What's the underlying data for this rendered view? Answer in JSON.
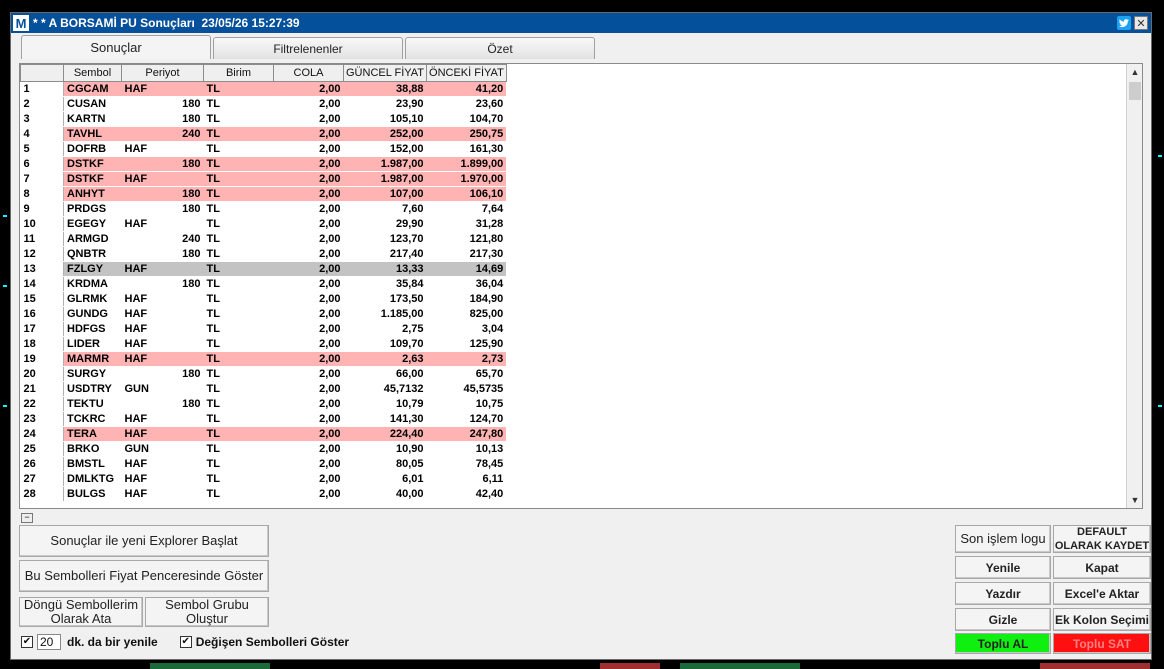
{
  "window": {
    "title": "* * A BORSAMİ PU Sonuçları  23/05/26 15:27:39",
    "logo": "M"
  },
  "tabs": [
    {
      "label": "Sonuçlar",
      "active": true
    },
    {
      "label": "Filtrelenenler",
      "active": false
    },
    {
      "label": "Özet",
      "active": false
    }
  ],
  "columns": [
    "",
    "Sembol",
    "Periyot",
    "Birim",
    "COLA",
    "GÜNCEL FİYAT",
    "ÖNCEKİ FİYAT"
  ],
  "rows": [
    {
      "no": "1",
      "sym": "CGCAM",
      "per": "HAF",
      "unit": "TL",
      "cola": "2,00",
      "cur": "38,88",
      "prev": "41,20",
      "style": "red"
    },
    {
      "no": "2",
      "sym": "CUSAN",
      "per": "180",
      "unit": "TL",
      "cola": "2,00",
      "cur": "23,90",
      "prev": "23,60",
      "style": ""
    },
    {
      "no": "3",
      "sym": "KARTN",
      "per": "180",
      "unit": "TL",
      "cola": "2,00",
      "cur": "105,10",
      "prev": "104,70",
      "style": ""
    },
    {
      "no": "4",
      "sym": "TAVHL",
      "per": "240",
      "unit": "TL",
      "cola": "2,00",
      "cur": "252,00",
      "prev": "250,75",
      "style": "red"
    },
    {
      "no": "5",
      "sym": "DOFRB",
      "per": "HAF",
      "unit": "TL",
      "cola": "2,00",
      "cur": "152,00",
      "prev": "161,30",
      "style": ""
    },
    {
      "no": "6",
      "sym": "DSTKF",
      "per": "180",
      "unit": "TL",
      "cola": "2,00",
      "cur": "1.987,00",
      "prev": "1.899,00",
      "style": "red"
    },
    {
      "no": "7",
      "sym": "DSTKF",
      "per": "HAF",
      "unit": "TL",
      "cola": "2,00",
      "cur": "1.987,00",
      "prev": "1.970,00",
      "style": "red"
    },
    {
      "no": "8",
      "sym": "ANHYT",
      "per": "180",
      "unit": "TL",
      "cola": "2,00",
      "cur": "107,00",
      "prev": "106,10",
      "style": "red"
    },
    {
      "no": "9",
      "sym": "PRDGS",
      "per": "180",
      "unit": "TL",
      "cola": "2,00",
      "cur": "7,60",
      "prev": "7,64",
      "style": ""
    },
    {
      "no": "10",
      "sym": "EGEGY",
      "per": "HAF",
      "unit": "TL",
      "cola": "2,00",
      "cur": "29,90",
      "prev": "31,28",
      "style": ""
    },
    {
      "no": "11",
      "sym": "ARMGD",
      "per": "240",
      "unit": "TL",
      "cola": "2,00",
      "cur": "123,70",
      "prev": "121,80",
      "style": ""
    },
    {
      "no": "12",
      "sym": "QNBTR",
      "per": "180",
      "unit": "TL",
      "cola": "2,00",
      "cur": "217,40",
      "prev": "217,30",
      "style": ""
    },
    {
      "no": "13",
      "sym": "FZLGY",
      "per": "HAF",
      "unit": "TL",
      "cola": "2,00",
      "cur": "13,33",
      "prev": "14,69",
      "style": "sel"
    },
    {
      "no": "14",
      "sym": "KRDMA",
      "per": "180",
      "unit": "TL",
      "cola": "2,00",
      "cur": "35,84",
      "prev": "36,04",
      "style": ""
    },
    {
      "no": "15",
      "sym": "GLRMK",
      "per": "HAF",
      "unit": "TL",
      "cola": "2,00",
      "cur": "173,50",
      "prev": "184,90",
      "style": ""
    },
    {
      "no": "16",
      "sym": "GUNDG",
      "per": "HAF",
      "unit": "TL",
      "cola": "2,00",
      "cur": "1.185,00",
      "prev": "825,00",
      "style": ""
    },
    {
      "no": "17",
      "sym": "HDFGS",
      "per": "HAF",
      "unit": "TL",
      "cola": "2,00",
      "cur": "2,75",
      "prev": "3,04",
      "style": ""
    },
    {
      "no": "18",
      "sym": "LIDER",
      "per": "HAF",
      "unit": "TL",
      "cola": "2,00",
      "cur": "109,70",
      "prev": "125,90",
      "style": ""
    },
    {
      "no": "19",
      "sym": "MARMR",
      "per": "HAF",
      "unit": "TL",
      "cola": "2,00",
      "cur": "2,63",
      "prev": "2,73",
      "style": "red"
    },
    {
      "no": "20",
      "sym": "SURGY",
      "per": "180",
      "unit": "TL",
      "cola": "2,00",
      "cur": "66,00",
      "prev": "65,70",
      "style": ""
    },
    {
      "no": "21",
      "sym": "USDTRY",
      "per": "GUN",
      "unit": "TL",
      "cola": "2,00",
      "cur": "45,7132",
      "prev": "45,5735",
      "style": ""
    },
    {
      "no": "22",
      "sym": "TEKTU",
      "per": "180",
      "unit": "TL",
      "cola": "2,00",
      "cur": "10,79",
      "prev": "10,75",
      "style": ""
    },
    {
      "no": "23",
      "sym": "TCKRC",
      "per": "HAF",
      "unit": "TL",
      "cola": "2,00",
      "cur": "141,30",
      "prev": "124,70",
      "style": ""
    },
    {
      "no": "24",
      "sym": "TERA",
      "per": "HAF",
      "unit": "TL",
      "cola": "2,00",
      "cur": "224,40",
      "prev": "247,80",
      "style": "red"
    },
    {
      "no": "25",
      "sym": "BRKO",
      "per": "GUN",
      "unit": "TL",
      "cola": "2,00",
      "cur": "10,90",
      "prev": "10,13",
      "style": ""
    },
    {
      "no": "26",
      "sym": "BMSTL",
      "per": "HAF",
      "unit": "TL",
      "cola": "2,00",
      "cur": "80,05",
      "prev": "78,45",
      "style": ""
    },
    {
      "no": "27",
      "sym": "DMLKTG",
      "per": "HAF",
      "unit": "TL",
      "cola": "2,00",
      "cur": "6,01",
      "prev": "6,11",
      "style": ""
    },
    {
      "no": "28",
      "sym": "BULGS",
      "per": "HAF",
      "unit": "TL",
      "cola": "2,00",
      "cur": "40,00",
      "prev": "42,40",
      "style": ""
    }
  ],
  "left_buttons": {
    "explorer": "Sonuçlar ile yeni Explorer Başlat",
    "price_window": "Bu Sembolleri Fiyat Penceresinde Göster",
    "loop_symbols": "Döngü Sembollerim Olarak Ata",
    "symbol_group": "Sembol Grubu Oluştur"
  },
  "refresh": {
    "checked": true,
    "minutes": "20",
    "label": "dk. da bir yenile"
  },
  "changed_symbols": {
    "checked": true,
    "label": "Değişen Sembolleri Göster"
  },
  "right_buttons": {
    "last_log": "Son işlem logu",
    "save_default": "DEFAULT OLARAK KAYDET",
    "refresh": "Yenile",
    "close": "Kapat",
    "print": "Yazdır",
    "export_excel": "Excel'e Aktar",
    "hide": "Gizle",
    "extra_columns": "Ek Kolon Seçimi",
    "bulk_buy": "Toplu AL",
    "bulk_sell": "Toplu SAT"
  },
  "colors": {
    "title_bar": "#05509a",
    "row_highlight": "#ffb3b3",
    "row_selected": "#c3c3c3",
    "buy": "#10f010",
    "sell": "#ff1010"
  }
}
